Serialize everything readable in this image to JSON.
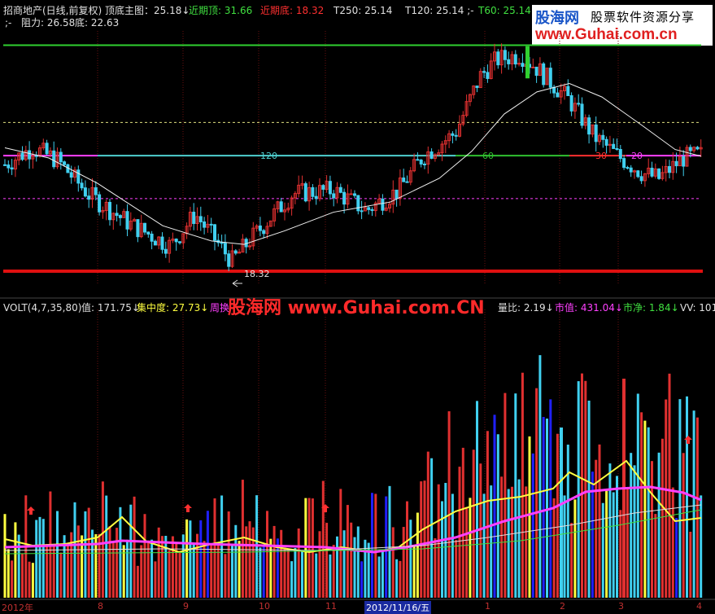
{
  "header1": {
    "title": "招商地产(日线,前复权) 顶底主图：25.18↓",
    "near_top": "近期顶: 31.66",
    "near_bottom": "近期底: 18.32",
    "t250": "T250: 25.14",
    "t120": "T120: 25.14 ;-",
    "t60": "T60: 25.14"
  },
  "header2": {
    "prefix": ";-",
    "resist": "阻力: 26.58",
    "bottom": "底: 22.63"
  },
  "logo": {
    "line1": "股海网",
    "line2": "股票软件资源分享",
    "line3": "www.Guhai.com.cn"
  },
  "watermark": "股海网 www.Guhai.com.CN",
  "price_chart": {
    "type": "candlestick",
    "ylim": [
      17.5,
      32.5
    ],
    "level_labels": [
      {
        "text": "120",
        "color": "#4fd0d0"
      },
      {
        "text": "60",
        "color": "#30c030"
      },
      {
        "text": "30",
        "color": "#ff3030"
      },
      {
        "text": "20",
        "color": "#ff40ff"
      }
    ],
    "low_label": "18.32",
    "levels": {
      "top": 31.66,
      "upper_dash": 27.1,
      "mid": 25.14,
      "lower_dash": 22.6,
      "bottom": 18.32
    }
  },
  "volume_chart": {
    "type": "bar",
    "indicator": "VOLT(4,7,35,80)",
    "value_label": "值: 171.75↓",
    "concentration": "集中度: 27.73↓",
    "turnover": "周换",
    "ratio_label": "量比: 2.19↓",
    "mkt_value": "市值: 431.04↓",
    "net_value": "市净: 1.84↓",
    "vv_label": "VV: 101!",
    "xticks": [
      "2012年",
      "8",
      "9",
      "10",
      "11",
      "2012/11/16/五",
      "1",
      "2",
      "3",
      "4"
    ]
  },
  "colors": {
    "up": "#e03030",
    "down": "#40d0f0",
    "green": "#30d030",
    "magenta": "#ff40ff",
    "yellow": "#ffff40",
    "red_line": "#e01010"
  }
}
